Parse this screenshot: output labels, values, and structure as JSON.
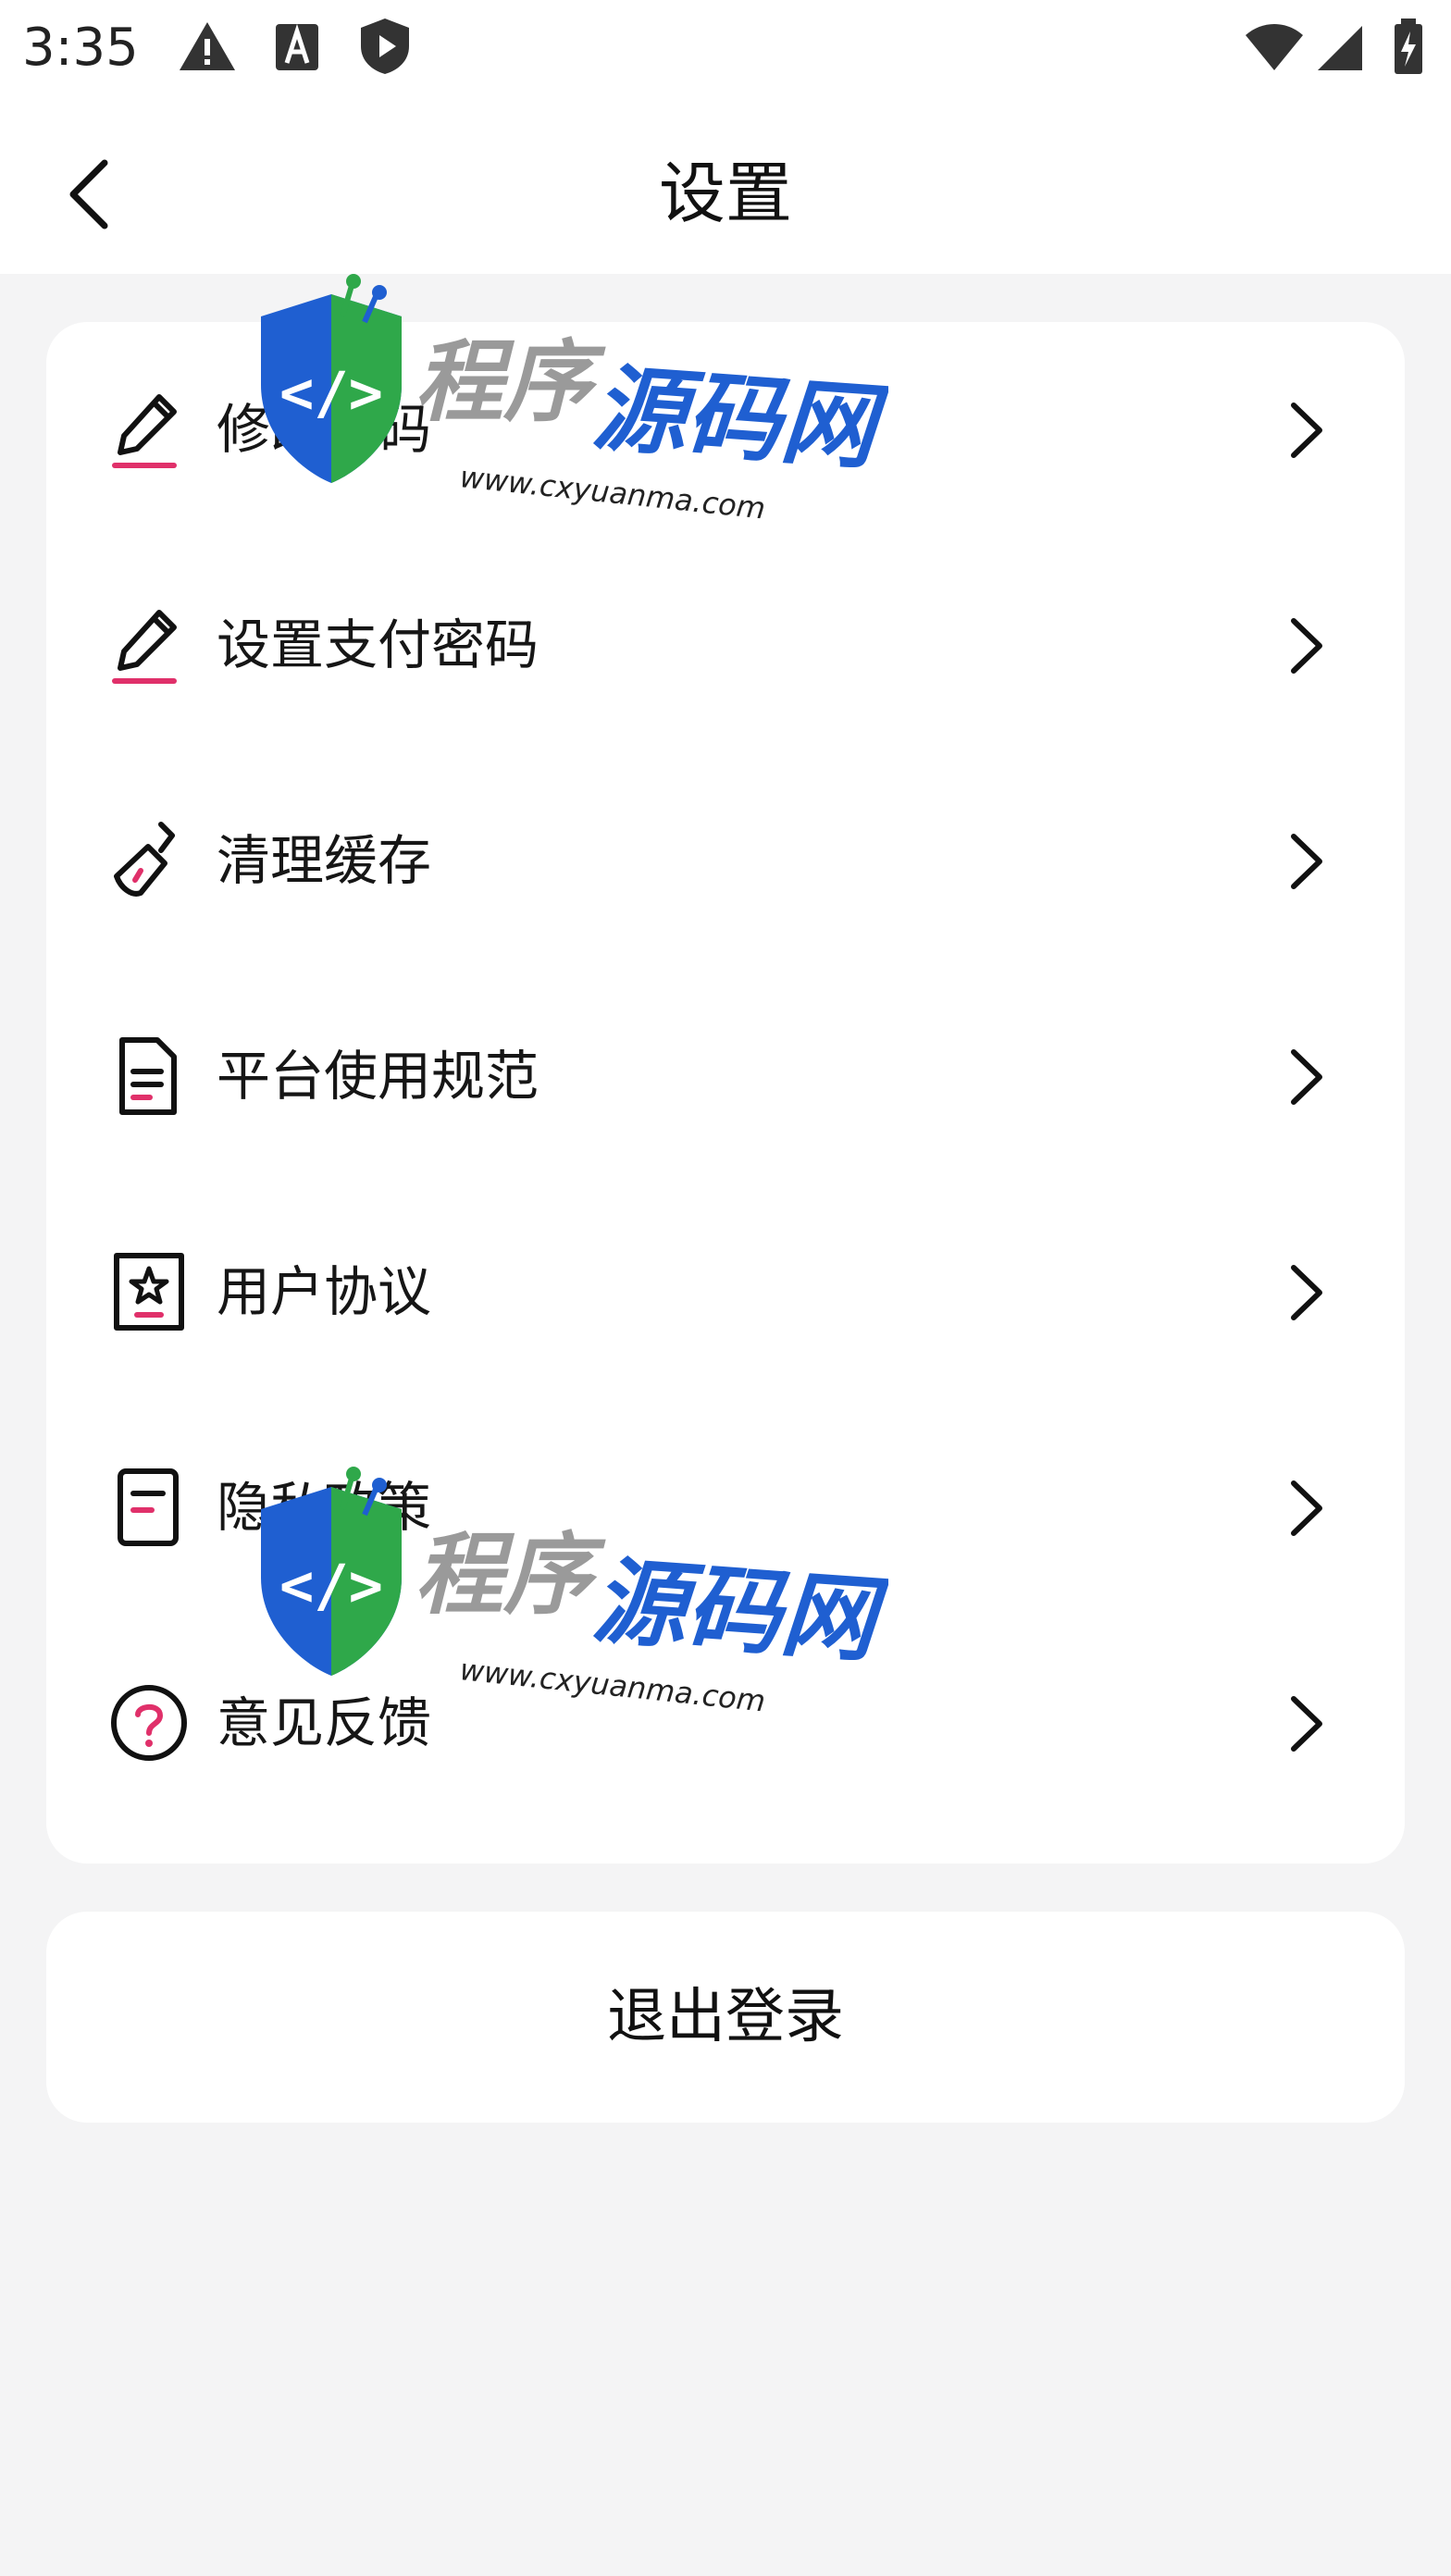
{
  "status_bar": {
    "time": "3:35",
    "icons": [
      "alert-icon",
      "font-a-icon",
      "shield-play-icon",
      "wifi-icon",
      "cellular-signal-icon",
      "battery-charging-icon"
    ]
  },
  "header": {
    "title": "设置",
    "back_icon": "chevron-left-icon"
  },
  "settings": {
    "items": [
      {
        "label": "修改密码",
        "icon": "pencil-icon",
        "chevron": "chevron-right-icon"
      },
      {
        "label": "设置支付密码",
        "icon": "pencil-icon",
        "chevron": "chevron-right-icon"
      },
      {
        "label": "清理缓存",
        "icon": "broom-icon",
        "chevron": "chevron-right-icon"
      },
      {
        "label": "平台使用规范",
        "icon": "document-icon",
        "chevron": "chevron-right-icon"
      },
      {
        "label": "用户协议",
        "icon": "star-document-icon",
        "chevron": "chevron-right-icon"
      },
      {
        "label": "隐私政策",
        "icon": "note-icon",
        "chevron": "chevron-right-icon"
      },
      {
        "label": "意见反馈",
        "icon": "question-circle-icon",
        "chevron": "chevron-right-icon"
      }
    ]
  },
  "logout": {
    "label": "退出登录"
  },
  "watermark": {
    "brand_gray": "程序",
    "brand_blue": "源码网",
    "url": "www.cxyuanma.com"
  },
  "colors": {
    "background": "#f4f4f5",
    "card": "#ffffff",
    "icon_accent": "#e0306a",
    "watermark_blue": "#1f5fd1",
    "watermark_green": "#2fa84a"
  }
}
